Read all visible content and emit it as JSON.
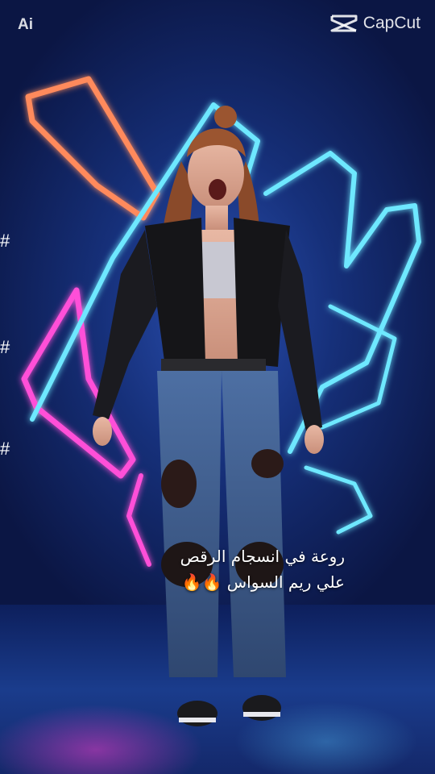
{
  "watermark": {
    "ai_label": "Ai",
    "brand": "CapCut",
    "brand_icon": "capcut-logo-icon"
  },
  "side_marks": [
    "#",
    "#",
    "#"
  ],
  "caption": {
    "line1": "روعة في انسجام الرقص",
    "line2": "علي ريم السواس 🔥🔥"
  },
  "colors": {
    "neon_orange": "#ff8a5c",
    "neon_pink": "#ff4fd8",
    "neon_cyan": "#6ee8ff",
    "background": "#16307a"
  }
}
